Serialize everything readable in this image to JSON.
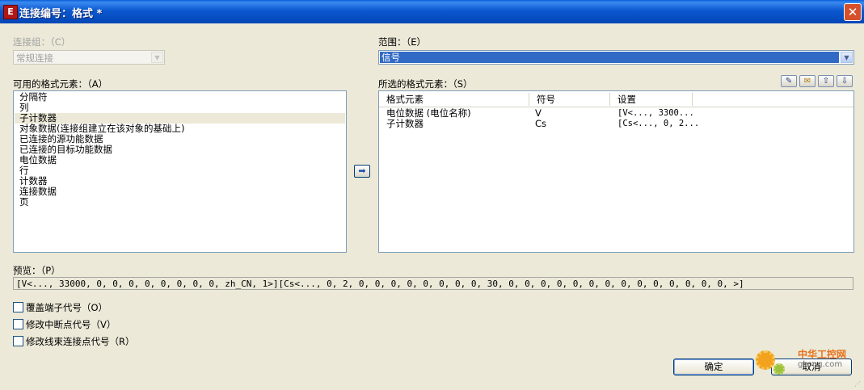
{
  "window": {
    "title": "连接编号：格式 *",
    "app_icon": "eplan-app-icon",
    "close_glyph": "✕"
  },
  "connection_group": {
    "label": "连接组：（C）",
    "value": "常规连接",
    "disabled": true
  },
  "scope": {
    "label": "范围：（E）",
    "value": "信号"
  },
  "available_elements": {
    "label": "可用的格式元素：（A）",
    "items": [
      "分隔符",
      "列",
      "子计数器",
      "对象数据(连接组建立在该对象的基础上)",
      "已连接的源功能数据",
      "已连接的目标功能数据",
      "电位数据",
      "行",
      "计数器",
      "连接数据",
      "页"
    ],
    "selected_index": 2
  },
  "move_button": {
    "icon": "arrow-right-icon",
    "glyph": "➡"
  },
  "selected_elements": {
    "label": "所选的格式元素：（S）",
    "toolbar": [
      {
        "name": "edit-icon",
        "glyph": "✎"
      },
      {
        "name": "delete-icon",
        "glyph": "✉"
      },
      {
        "name": "move-up-icon",
        "glyph": "⇧"
      },
      {
        "name": "move-down-icon",
        "glyph": "⇩"
      }
    ],
    "columns": [
      "格式元素",
      "符号",
      "设置"
    ],
    "rows": [
      [
        "电位数据 (电位名称)",
        "V",
        "[V<..., 3300..."
      ],
      [
        "子计数器",
        "Cs",
        "[Cs<..., 0, 2..."
      ]
    ]
  },
  "preview": {
    "label": "预览：（P）",
    "value": "[V<..., 33000, 0, 0, 0, 0, 0, 0, 0, 0, zh_CN, 1>][Cs<..., 0, 2, 0, 0, 0, 0, 0, 0, 0, 0, 30, 0, 0, 0, 0, 0, 0, 0, 0, 0, 0, 0, 0, 0, 0, >]"
  },
  "options": [
    {
      "label": "覆盖端子代号（O）",
      "checked": false
    },
    {
      "label": "修改中断点代号（V）",
      "checked": false
    },
    {
      "label": "修改线束连接点代号（R）",
      "checked": false
    }
  ],
  "buttons": {
    "ok": "确定",
    "cancel": "取消"
  },
  "watermark": {
    "text": "中华工控网",
    "url": "gkong.com"
  },
  "colors": {
    "titlebar": "#0246b6",
    "selection": "#316ac5",
    "dialog_bg": "#ece9d8"
  }
}
